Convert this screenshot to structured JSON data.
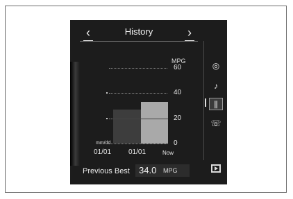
{
  "header": {
    "title": "History",
    "prev_glyph": "‹",
    "next_glyph": "›"
  },
  "graph": {
    "unit": "MPG",
    "ticks": [
      "60",
      "40",
      "20",
      "0"
    ],
    "date_caption": "mm/dd",
    "x_labels": [
      "01/01",
      "01/01",
      "Now"
    ]
  },
  "chart_data": {
    "type": "bar",
    "categories": [
      "01/01",
      "01/01",
      "Now"
    ],
    "values": [
      null,
      27,
      33
    ],
    "ylabel": "MPG",
    "ylim": [
      0,
      60
    ]
  },
  "sidebar": {
    "icons": [
      "navigation-icon",
      "audio-icon",
      "fuel-history-icon",
      "phone-icon"
    ],
    "glyphs": [
      "◎",
      "♪",
      "⫼",
      "☏"
    ],
    "selected": "fuel-history-icon",
    "bottom_icon": "display-icon"
  },
  "footer": {
    "label": "Previous Best",
    "value": "34.0",
    "unit": "MPG"
  },
  "colors": {
    "screen_bg": "#1c1c1c",
    "bar_past": "#3d3d3d",
    "bar_now": "#a9a9a9"
  }
}
